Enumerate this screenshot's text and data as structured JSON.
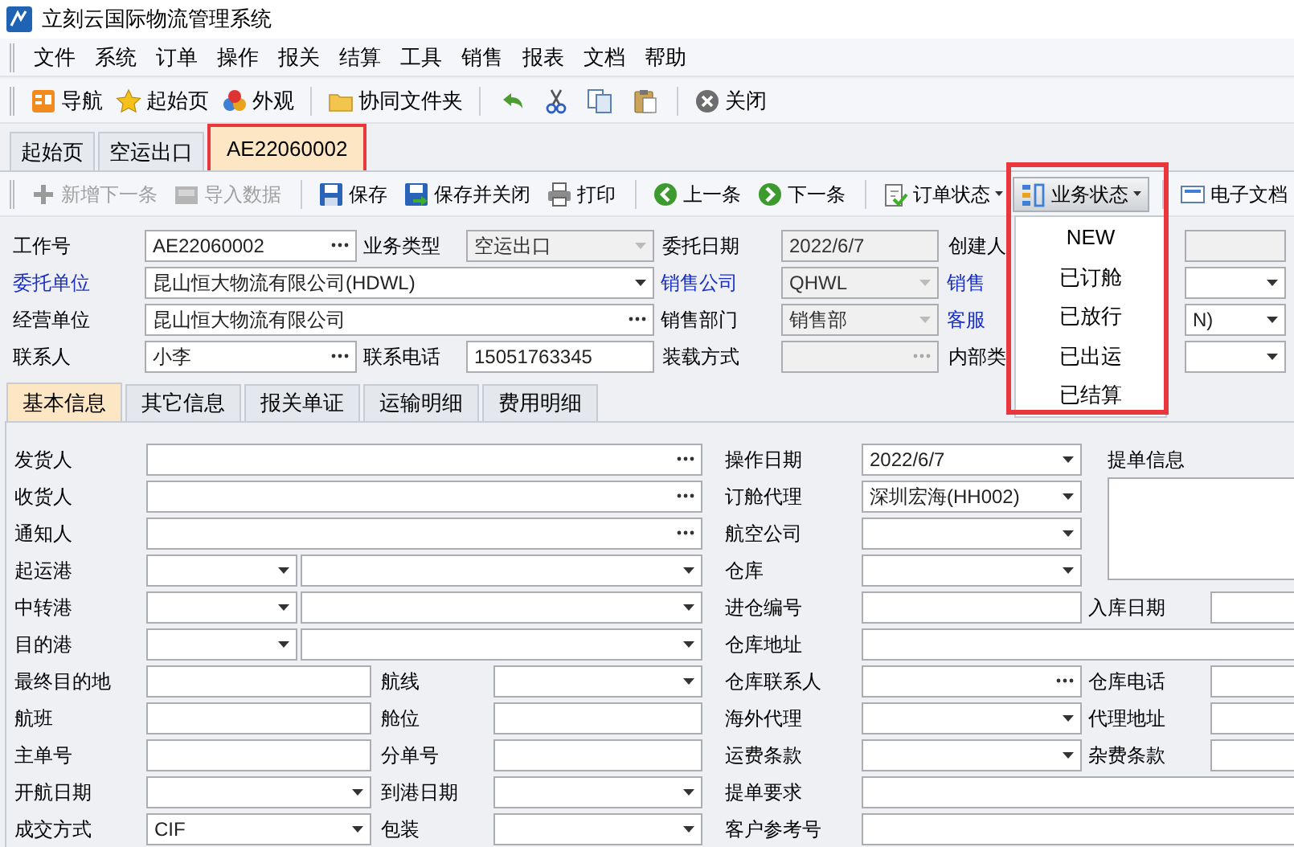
{
  "window": {
    "title": "立刻云国际物流管理系统"
  },
  "menu": [
    "文件",
    "系统",
    "订单",
    "操作",
    "报关",
    "结算",
    "工具",
    "销售",
    "报表",
    "文档",
    "帮助"
  ],
  "toolbar": [
    {
      "label": "导航"
    },
    {
      "label": "起始页"
    },
    {
      "label": "外观"
    },
    {
      "label": "协同文件夹"
    },
    {
      "label": "关闭"
    }
  ],
  "doc_tabs": [
    {
      "label": "起始页",
      "selected": false,
      "highlighted": false
    },
    {
      "label": "空运出口",
      "selected": false,
      "highlighted": false
    },
    {
      "label": "AE22060002",
      "selected": true,
      "highlighted": true
    }
  ],
  "record_toolbar": [
    {
      "label": "新增下一条",
      "disabled": true,
      "dropdown": false
    },
    {
      "label": "导入数据",
      "disabled": true,
      "dropdown": false
    },
    {
      "label": "保存",
      "disabled": false,
      "dropdown": false
    },
    {
      "label": "保存并关闭",
      "disabled": false,
      "dropdown": false
    },
    {
      "label": "打印",
      "disabled": false,
      "dropdown": false
    },
    {
      "label": "上一条",
      "disabled": false,
      "dropdown": false
    },
    {
      "label": "下一条",
      "disabled": false,
      "dropdown": false
    },
    {
      "label": "订单状态",
      "disabled": false,
      "dropdown": true
    },
    {
      "label": "业务状态",
      "disabled": false,
      "dropdown": true,
      "expanded": true,
      "highlighted": true,
      "menu": [
        "NEW",
        "已订舱",
        "已放行",
        "已出运",
        "已结算"
      ]
    },
    {
      "label": "电子文档",
      "disabled": false,
      "dropdown": false
    }
  ],
  "header_fields": [
    [
      {
        "label": "工作号",
        "link": false,
        "kind": "lookup",
        "value": "AE22060002",
        "disabled": false,
        "wide": false
      },
      {
        "label": "业务类型",
        "link": false,
        "kind": "dropdown",
        "value": "空运出口",
        "disabled": true,
        "wide": false
      },
      {
        "label": "委托日期",
        "link": false,
        "kind": "text",
        "value": "2022/6/7",
        "disabled": true,
        "wide": false
      },
      {
        "label": "创建人",
        "link": false,
        "kind": "text",
        "disabled": true,
        "wide": false
      }
    ],
    [
      {
        "label": "委托单位",
        "link": true,
        "kind": "dropdown",
        "value": "昆山恒大物流有限公司(HDWL)",
        "disabled": false,
        "wide": true
      },
      {
        "label": "销售公司",
        "link": true,
        "kind": "dropdown",
        "value": "QHWL",
        "disabled": true,
        "wide": false
      },
      {
        "label": "销售",
        "link": true,
        "kind": "dropdown",
        "disabled": false,
        "wide": false
      }
    ],
    [
      {
        "label": "经营单位",
        "link": false,
        "kind": "lookup",
        "value": "昆山恒大物流有限公司",
        "disabled": false,
        "wide": true
      },
      {
        "label": "销售部门",
        "link": false,
        "kind": "dropdown",
        "value": "销售部",
        "disabled": true,
        "wide": false
      },
      {
        "label": "客服",
        "link": true,
        "kind": "dropdown",
        "value": "N)",
        "disabled": false,
        "wide": false
      }
    ],
    [
      {
        "label": "联系人",
        "link": false,
        "kind": "lookup",
        "value": "小李",
        "disabled": false,
        "wide": false
      },
      {
        "label": "联系电话",
        "link": false,
        "kind": "text",
        "value": "15051763345",
        "disabled": false,
        "wide": false
      },
      {
        "label": "装载方式",
        "link": false,
        "kind": "lookup",
        "disabled": true,
        "wide": false
      },
      {
        "label": "内部类",
        "link": false,
        "kind": "dropdown",
        "disabled": false,
        "wide": false
      }
    ]
  ],
  "detail_tabs": [
    {
      "label": "基本信息",
      "selected": true
    },
    {
      "label": "其它信息",
      "selected": false
    },
    {
      "label": "报关单证",
      "selected": false
    },
    {
      "label": "运输明细",
      "selected": false
    },
    {
      "label": "费用明细",
      "selected": false
    }
  ],
  "left_rows": [
    {
      "kind": "full",
      "label": "发货人",
      "fields": [
        {
          "kind": "lookup"
        }
      ]
    },
    {
      "kind": "full",
      "label": "收货人",
      "fields": [
        {
          "kind": "lookup"
        }
      ]
    },
    {
      "kind": "full",
      "label": "通知人",
      "fields": [
        {
          "kind": "lookup"
        }
      ]
    },
    {
      "kind": "ports",
      "label": "起运港",
      "fields": [
        {
          "kind": "dropdown"
        },
        {
          "kind": "dropdown"
        }
      ]
    },
    {
      "kind": "ports",
      "label": "中转港",
      "fields": [
        {
          "kind": "dropdown"
        },
        {
          "kind": "dropdown"
        }
      ]
    },
    {
      "kind": "ports",
      "label": "目的港",
      "fields": [
        {
          "kind": "dropdown"
        },
        {
          "kind": "dropdown"
        }
      ]
    },
    {
      "kind": "pair",
      "label": "最终目的地",
      "label2": "航线",
      "fields": [
        {
          "kind": "text"
        },
        {
          "kind": "dropdown"
        }
      ]
    },
    {
      "kind": "pair",
      "label": "航班",
      "label2": "舱位",
      "fields": [
        {
          "kind": "text"
        },
        {
          "kind": "text"
        }
      ]
    },
    {
      "kind": "pair",
      "label": "主单号",
      "label2": "分单号",
      "fields": [
        {
          "kind": "text"
        },
        {
          "kind": "text"
        }
      ]
    },
    {
      "kind": "pair",
      "label": "开航日期",
      "label2": "到港日期",
      "fields": [
        {
          "kind": "dropdown"
        },
        {
          "kind": "dropdown"
        }
      ]
    },
    {
      "kind": "pair",
      "label": "成交方式",
      "label2": "包装",
      "fields": [
        {
          "kind": "dropdown",
          "value": "CIF"
        },
        {
          "kind": "dropdown"
        }
      ]
    }
  ],
  "right_rows": [
    {
      "label": "操作日期",
      "field": {
        "kind": "dropdown",
        "value": "2022/6/7"
      },
      "wide": false,
      "extra_label": "提单信息"
    },
    {
      "label": "订舱代理",
      "field": {
        "kind": "dropdown",
        "value": "深圳宏海(HH002)"
      },
      "wide": false
    },
    {
      "label": "航空公司",
      "field": {
        "kind": "dropdown"
      },
      "wide": false
    },
    {
      "label": "仓库",
      "field": {
        "kind": "dropdown"
      },
      "wide": false
    },
    {
      "label": "进仓编号",
      "field": {
        "kind": "text"
      },
      "wide": false,
      "extra_label": "入库日期",
      "extra_field": {
        "kind": "text"
      }
    },
    {
      "label": "仓库地址",
      "field": {
        "kind": "text"
      },
      "wide": true
    },
    {
      "label": "仓库联系人",
      "field": {
        "kind": "lookup"
      },
      "wide": false,
      "extra_label": "仓库电话",
      "extra_field": {
        "kind": "text"
      }
    },
    {
      "label": "海外代理",
      "field": {
        "kind": "dropdown"
      },
      "wide": false,
      "extra_label": "代理地址",
      "extra_field": {
        "kind": "text"
      }
    },
    {
      "label": "运费条款",
      "field": {
        "kind": "dropdown"
      },
      "wide": false,
      "extra_label": "杂费条款",
      "extra_field": {
        "kind": "text"
      }
    },
    {
      "label": "提单要求",
      "field": {
        "kind": "text"
      },
      "wide": true
    },
    {
      "label": "客户参考号",
      "field": {
        "kind": "text"
      },
      "wide": true
    }
  ]
}
